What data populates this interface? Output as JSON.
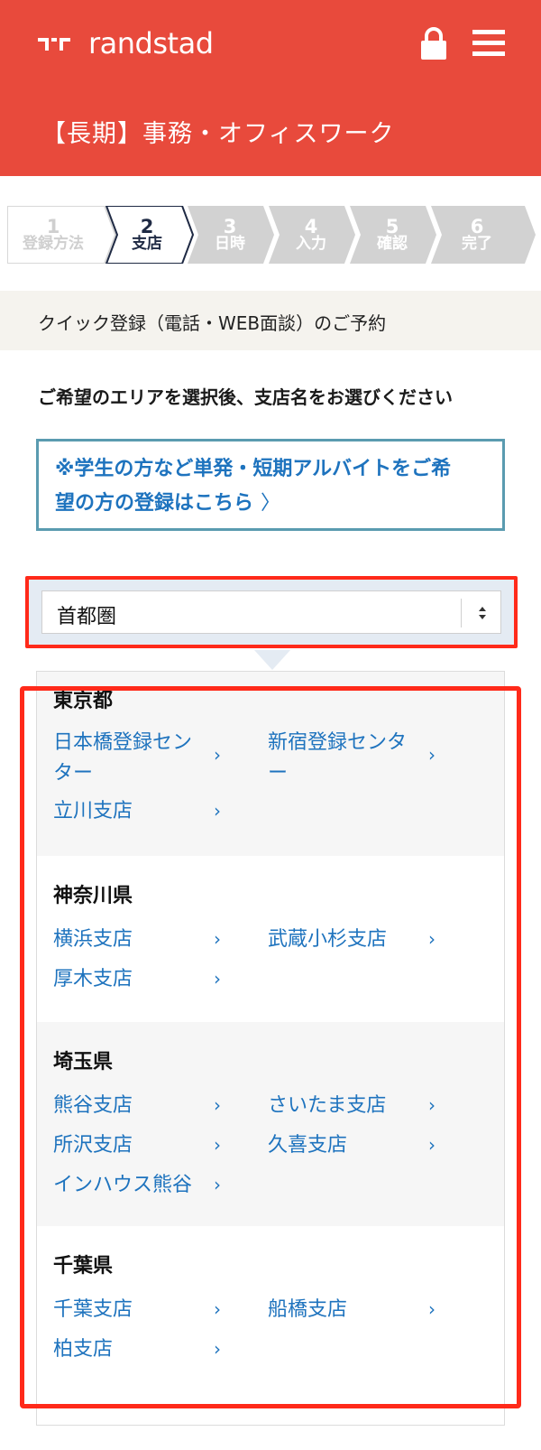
{
  "header": {
    "brand": "randstad",
    "title": "【長期】事務・オフィスワーク",
    "colors": {
      "brand_red": "#e84a3c",
      "link_blue": "#1e73be"
    }
  },
  "steps": [
    {
      "num": "1",
      "label": "登録方法",
      "state": "done"
    },
    {
      "num": "2",
      "label": "支店",
      "state": "active"
    },
    {
      "num": "3",
      "label": "日時",
      "state": "todo"
    },
    {
      "num": "4",
      "label": "入力",
      "state": "todo"
    },
    {
      "num": "5",
      "label": "確認",
      "state": "todo"
    },
    {
      "num": "6",
      "label": "完了",
      "state": "todo"
    }
  ],
  "subtitle": "クイック登録（電話・WEB面談）のご予約",
  "instruction": "ご希望のエリアを選択後、支店名をお選びください",
  "notice": {
    "line1": "※学生の方など単発・短期アルバイトをご希",
    "line2": "望の方の登録はこちら",
    "chevron": "〉"
  },
  "area_select": {
    "value": "首都圏"
  },
  "regions": [
    {
      "name": "東京都",
      "branches": [
        {
          "line1": "日本橋登録セン",
          "line2": "ター"
        },
        {
          "line1": "新宿登録センタ",
          "line2": "ー"
        },
        {
          "line1": "立川支店",
          "line2": ""
        }
      ]
    },
    {
      "name": "神奈川県",
      "branches": [
        {
          "line1": "横浜支店",
          "line2": ""
        },
        {
          "line1": "武蔵小杉支店",
          "line2": ""
        },
        {
          "line1": "厚木支店",
          "line2": ""
        }
      ]
    },
    {
      "name": "埼玉県",
      "branches": [
        {
          "line1": "熊谷支店",
          "line2": ""
        },
        {
          "line1": "さいたま支店",
          "line2": ""
        },
        {
          "line1": "所沢支店",
          "line2": ""
        },
        {
          "line1": "久喜支店",
          "line2": ""
        },
        {
          "line1": "インハウス熊谷",
          "line2": ""
        }
      ]
    },
    {
      "name": "千葉県",
      "branches": [
        {
          "line1": "千葉支店",
          "line2": ""
        },
        {
          "line1": "船橋支店",
          "line2": ""
        },
        {
          "line1": "柏支店",
          "line2": ""
        }
      ]
    }
  ],
  "chevron": "›"
}
